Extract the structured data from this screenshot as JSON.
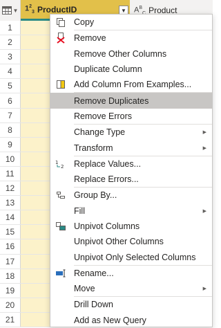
{
  "header": {
    "col1": {
      "type_icon": "1²₃",
      "name": "ProductID"
    },
    "col2": {
      "type_icon": "Aᴮc",
      "name": "Product"
    }
  },
  "rows": [
    "1",
    "2",
    "3",
    "4",
    "5",
    "6",
    "7",
    "8",
    "9",
    "10",
    "11",
    "12",
    "13",
    "14",
    "15",
    "16",
    "17",
    "18",
    "19",
    "20",
    "21"
  ],
  "menu": {
    "items": [
      {
        "label": "Copy",
        "icon": "copy-icon"
      },
      {
        "label": "Remove",
        "icon": "remove-column-icon"
      },
      {
        "label": "Remove Other Columns"
      },
      {
        "label": "Duplicate Column"
      },
      {
        "label": "Add Column From Examples...",
        "icon": "column-examples-icon"
      },
      {
        "label": "Remove Duplicates",
        "highlighted": true
      },
      {
        "label": "Remove Errors"
      },
      {
        "label": "Change Type",
        "submenu": true
      },
      {
        "label": "Transform",
        "submenu": true
      },
      {
        "label": "Replace Values...",
        "icon": "replace-values-icon"
      },
      {
        "label": "Replace Errors..."
      },
      {
        "label": "Group By...",
        "icon": "group-by-icon"
      },
      {
        "label": "Fill",
        "submenu": true
      },
      {
        "label": "Unpivot Columns",
        "icon": "unpivot-icon"
      },
      {
        "label": "Unpivot Other Columns"
      },
      {
        "label": "Unpivot Only Selected Columns"
      },
      {
        "label": "Rename...",
        "icon": "rename-icon"
      },
      {
        "label": "Move",
        "submenu": true
      },
      {
        "label": "Drill Down"
      },
      {
        "label": "Add as New Query"
      }
    ]
  },
  "colors": {
    "column_header_selected": "#e2c04a",
    "column_underline": "#2a8a86",
    "menu_highlight": "#c8c6c4"
  }
}
